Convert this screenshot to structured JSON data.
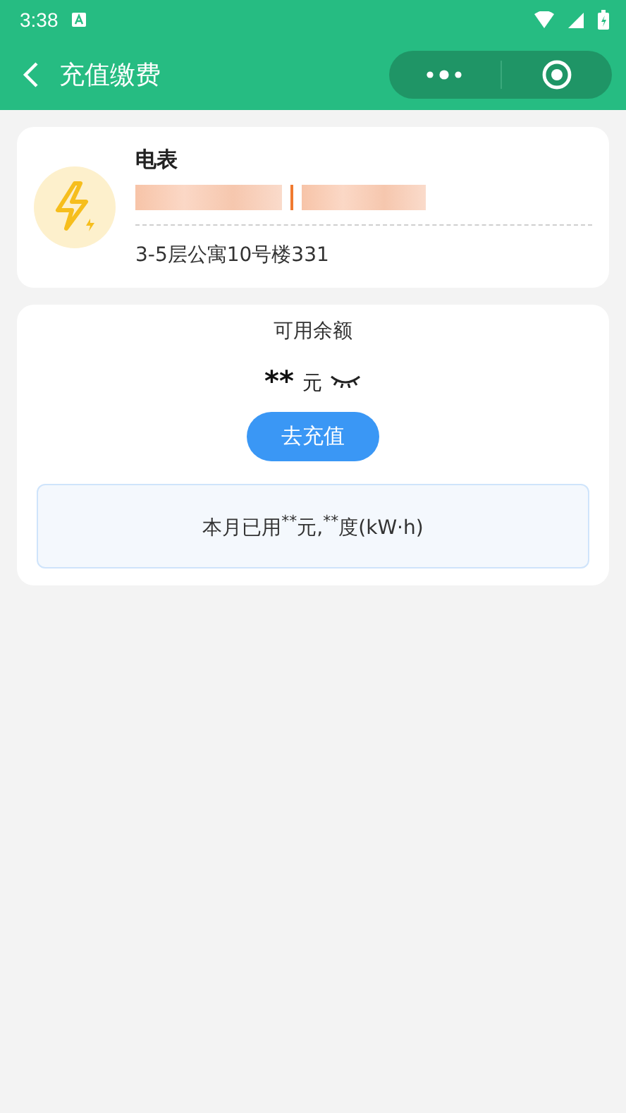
{
  "status_bar": {
    "time": "3:38"
  },
  "nav_bar": {
    "title": "充值缴费"
  },
  "meter_card": {
    "type": "电表",
    "address": "3-5层公寓10号楼331"
  },
  "balance_card": {
    "label": "可用余额",
    "amount": "**",
    "unit": "元",
    "amount_hidden": true,
    "button": "去充值",
    "usage": "本月已用$^{**}$元,$^{**}$度(kW·h)"
  }
}
